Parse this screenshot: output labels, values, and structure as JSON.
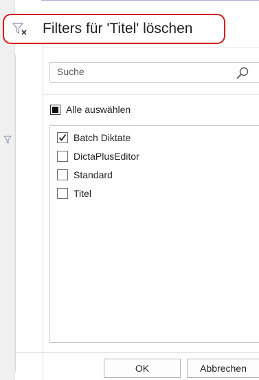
{
  "menu": {
    "clear_filter_label": "Filters für 'Titel' löschen"
  },
  "search": {
    "placeholder": "Suche"
  },
  "select_all": {
    "label": "Alle auswählen",
    "state": "indeterminate"
  },
  "list": {
    "items": [
      {
        "label": "Batch Diktate",
        "checked": true
      },
      {
        "label": "DictaPlusEditor",
        "checked": false
      },
      {
        "label": "Standard",
        "checked": false
      },
      {
        "label": "Titel",
        "checked": false
      }
    ]
  },
  "buttons": {
    "ok": "OK",
    "cancel": "Abbrechen"
  },
  "colors": {
    "highlight_border": "#d6191c",
    "filter_icon": "#8a8fb0",
    "clear_x": "#333333"
  }
}
